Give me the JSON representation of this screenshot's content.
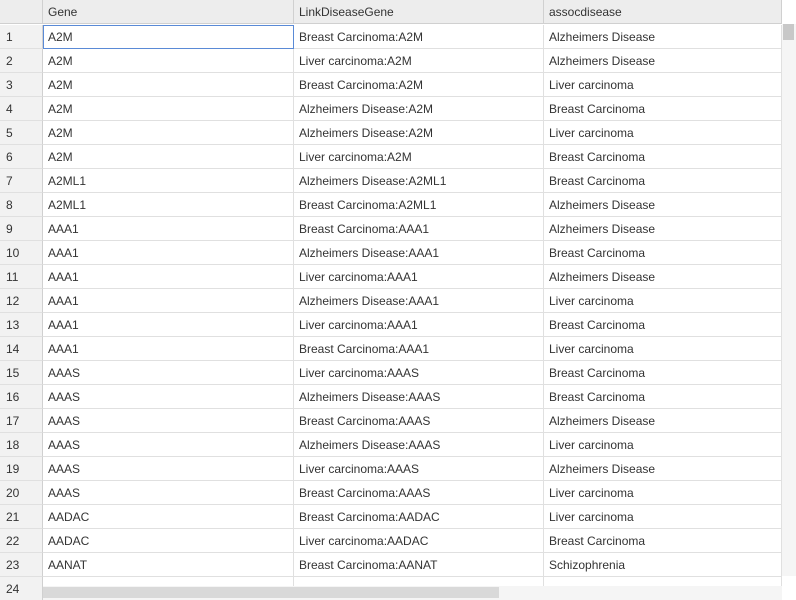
{
  "columns": [
    "Gene",
    "LinkDiseaseGene",
    "assocdisease"
  ],
  "rows": [
    {
      "n": "1",
      "gene": "A2M",
      "link": "Breast Carcinoma:A2M",
      "assoc": "Alzheimers Disease"
    },
    {
      "n": "2",
      "gene": "A2M",
      "link": "Liver carcinoma:A2M",
      "assoc": "Alzheimers Disease"
    },
    {
      "n": "3",
      "gene": "A2M",
      "link": "Breast Carcinoma:A2M",
      "assoc": "Liver carcinoma"
    },
    {
      "n": "4",
      "gene": "A2M",
      "link": "Alzheimers Disease:A2M",
      "assoc": "Breast Carcinoma"
    },
    {
      "n": "5",
      "gene": "A2M",
      "link": "Alzheimers Disease:A2M",
      "assoc": "Liver carcinoma"
    },
    {
      "n": "6",
      "gene": "A2M",
      "link": "Liver carcinoma:A2M",
      "assoc": "Breast Carcinoma"
    },
    {
      "n": "7",
      "gene": "A2ML1",
      "link": "Alzheimers Disease:A2ML1",
      "assoc": "Breast Carcinoma"
    },
    {
      "n": "8",
      "gene": "A2ML1",
      "link": "Breast Carcinoma:A2ML1",
      "assoc": "Alzheimers Disease"
    },
    {
      "n": "9",
      "gene": "AAA1",
      "link": "Breast Carcinoma:AAA1",
      "assoc": "Alzheimers Disease"
    },
    {
      "n": "10",
      "gene": "AAA1",
      "link": "Alzheimers Disease:AAA1",
      "assoc": "Breast Carcinoma"
    },
    {
      "n": "11",
      "gene": "AAA1",
      "link": "Liver carcinoma:AAA1",
      "assoc": "Alzheimers Disease"
    },
    {
      "n": "12",
      "gene": "AAA1",
      "link": "Alzheimers Disease:AAA1",
      "assoc": "Liver carcinoma"
    },
    {
      "n": "13",
      "gene": "AAA1",
      "link": "Liver carcinoma:AAA1",
      "assoc": "Breast Carcinoma"
    },
    {
      "n": "14",
      "gene": "AAA1",
      "link": "Breast Carcinoma:AAA1",
      "assoc": "Liver carcinoma"
    },
    {
      "n": "15",
      "gene": "AAAS",
      "link": "Liver carcinoma:AAAS",
      "assoc": "Breast Carcinoma"
    },
    {
      "n": "16",
      "gene": "AAAS",
      "link": "Alzheimers Disease:AAAS",
      "assoc": "Breast Carcinoma"
    },
    {
      "n": "17",
      "gene": "AAAS",
      "link": "Breast Carcinoma:AAAS",
      "assoc": "Alzheimers Disease"
    },
    {
      "n": "18",
      "gene": "AAAS",
      "link": "Alzheimers Disease:AAAS",
      "assoc": "Liver carcinoma"
    },
    {
      "n": "19",
      "gene": "AAAS",
      "link": "Liver carcinoma:AAAS",
      "assoc": "Alzheimers Disease"
    },
    {
      "n": "20",
      "gene": "AAAS",
      "link": "Breast Carcinoma:AAAS",
      "assoc": "Liver carcinoma"
    },
    {
      "n": "21",
      "gene": "AADAC",
      "link": "Breast Carcinoma:AADAC",
      "assoc": "Liver carcinoma"
    },
    {
      "n": "22",
      "gene": "AADAC",
      "link": "Liver carcinoma:AADAC",
      "assoc": "Breast Carcinoma"
    },
    {
      "n": "23",
      "gene": "AANAT",
      "link": "Breast Carcinoma:AANAT",
      "assoc": "Schizophrenia"
    },
    {
      "n": "24",
      "gene": "",
      "link": "",
      "assoc": ""
    }
  ]
}
